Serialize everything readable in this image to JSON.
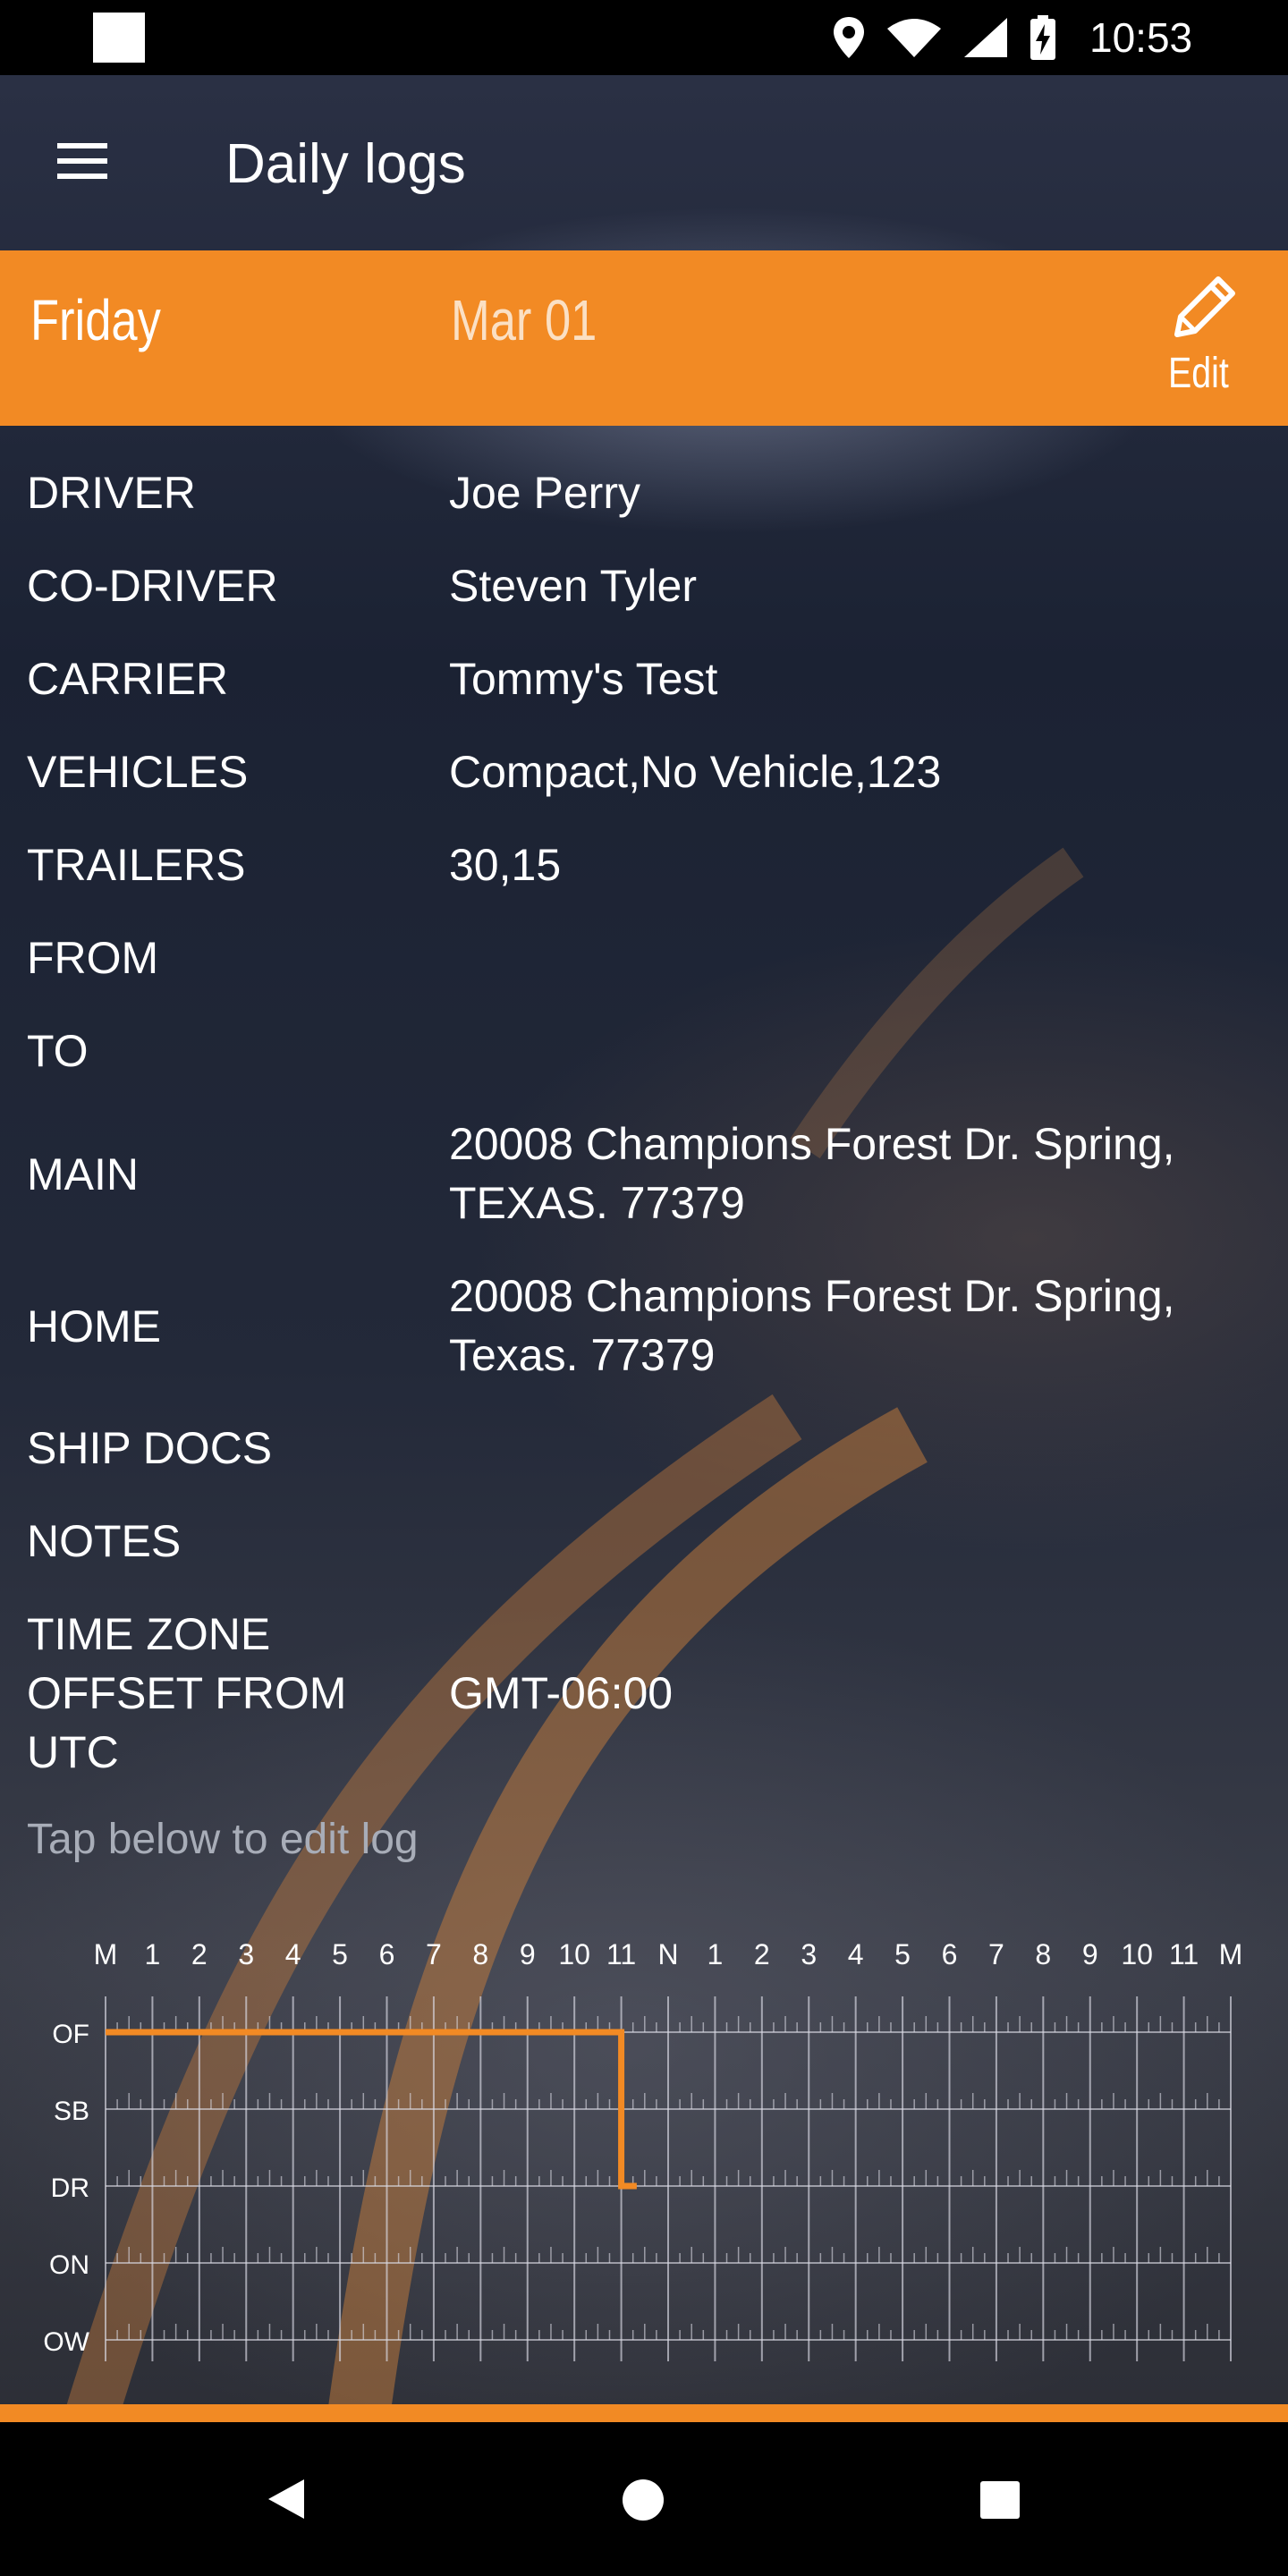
{
  "status_bar": {
    "time": "10:53"
  },
  "app_bar": {
    "title": "Daily logs"
  },
  "date_band": {
    "day": "Friday",
    "date": "Mar 01",
    "edit_label": "Edit"
  },
  "details": [
    {
      "label": "DRIVER",
      "value": "Joe Perry"
    },
    {
      "label": "CO-DRIVER",
      "value": "Steven Tyler"
    },
    {
      "label": "CARRIER",
      "value": "Tommy's Test"
    },
    {
      "label": "VEHICLES",
      "value": "Compact,No Vehicle,123"
    },
    {
      "label": "TRAILERS",
      "value": "30,15"
    },
    {
      "label": "FROM",
      "value": ""
    },
    {
      "label": "TO",
      "value": ""
    },
    {
      "label": "MAIN",
      "value": "20008 Champions Forest Dr. Spring, TEXAS. 77379"
    },
    {
      "label": "HOME",
      "value": "20008 Champions Forest Dr. Spring, Texas. 77379"
    },
    {
      "label": "SHIP DOCS",
      "value": ""
    },
    {
      "label": "NOTES",
      "value": ""
    },
    {
      "label": "TIME ZONE OFFSET FROM UTC",
      "value": "GMT-06:00"
    }
  ],
  "hint": "Tap below to edit log",
  "log_graph": {
    "hour_labels": [
      "M",
      "1",
      "2",
      "3",
      "4",
      "5",
      "6",
      "7",
      "8",
      "9",
      "10",
      "11",
      "N",
      "1",
      "2",
      "3",
      "4",
      "5",
      "6",
      "7",
      "8",
      "9",
      "10",
      "11",
      "M"
    ],
    "status_labels": [
      "OF",
      "SB",
      "DR",
      "ON",
      "OW"
    ],
    "line_color": "#f28a24",
    "segments": [
      {
        "status": "OF",
        "start_hour": 0,
        "end_hour": 11.0
      },
      {
        "status": "DR",
        "start_hour": 11.0,
        "end_hour": 11.33
      }
    ]
  }
}
